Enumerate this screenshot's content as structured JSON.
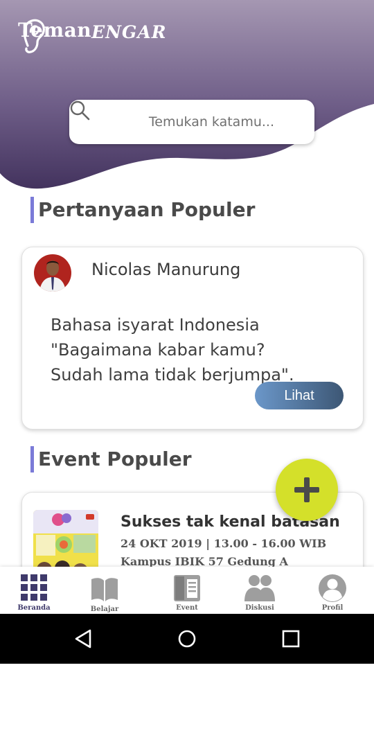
{
  "app": {
    "logo_part1": "Teman",
    "logo_part2": "ENGAR"
  },
  "search": {
    "placeholder": "Temukan katamu..."
  },
  "questions_section": {
    "title": "Pertanyaan Populer",
    "card": {
      "user_name": "Nicolas Manurung",
      "lines": [
        "Bahasa isyarat Indonesia",
        "\"Bagaimana kabar kamu?",
        "Sudah lama tidak berjumpa\"."
      ],
      "button_label": "Lihat"
    }
  },
  "events_section": {
    "title": "Event Populer",
    "card": {
      "title": "Sukses tak kenal batasan",
      "date": "24 OKT 2019 | 13.00 - 16.00 WIB",
      "place": "Kampus IBIK 57 Gedung A"
    }
  },
  "fab": {
    "icon": "plus-icon"
  },
  "bottom_nav": {
    "items": [
      {
        "label": "Beranda",
        "icon": "grid-icon",
        "active": true
      },
      {
        "label": "Belajar",
        "icon": "book-icon",
        "active": false
      },
      {
        "label": "Event",
        "icon": "event-icon",
        "active": false
      },
      {
        "label": "Diskusi",
        "icon": "people-icon",
        "active": false
      },
      {
        "label": "Profil",
        "icon": "profile-icon",
        "active": false
      }
    ]
  },
  "system_nav": {
    "buttons": [
      "back-icon",
      "home-icon",
      "recents-icon"
    ]
  },
  "colors": {
    "header_top": "#9a8ca8",
    "header_bottom": "#4b3a66",
    "accent_bar": "#7b7bd8",
    "fab": "#d4e02a",
    "nav_active": "#3f3a6b",
    "nav_inactive": "#9e9e9e",
    "button_gradient_start": "#6b97c9",
    "button_gradient_end": "#3d5775"
  }
}
